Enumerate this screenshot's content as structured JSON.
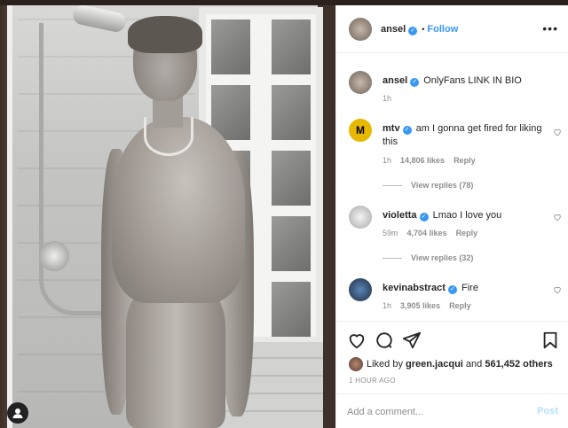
{
  "post": {
    "username": "ansel",
    "follow_label": "Follow",
    "dot": "•",
    "more_label": "•••",
    "caption": "OnlyFans LINK IN BIO",
    "caption_time": "1h"
  },
  "comments": [
    {
      "user": "mtv",
      "text": "am I gonna get fired for liking this",
      "time": "1h",
      "likes": "14,806 likes",
      "reply_label": "Reply",
      "view_replies": "View replies (78)"
    },
    {
      "user": "violetta",
      "text": "Lmao I love you",
      "time": "59m",
      "likes": "4,704 likes",
      "reply_label": "Reply",
      "view_replies": "View replies (32)"
    },
    {
      "user": "kevinabstract",
      "text": "Fire",
      "time": "1h",
      "likes": "3,905 likes",
      "reply_label": "Reply"
    }
  ],
  "likes": {
    "prefix": "Liked by",
    "first_user": "green.jacqui",
    "and": "and",
    "others": "561,452 others"
  },
  "time_ago": "1 HOUR AGO",
  "comment_box": {
    "placeholder": "Add a comment...",
    "post_label": "Post"
  },
  "logo_text": {
    "mtv": "M"
  },
  "colors": {
    "accent": "#3897f0",
    "post_disabled": "#b2dffc",
    "meta": "#8e8e8e"
  },
  "icons": [
    "like-icon",
    "comment-icon",
    "share-icon",
    "save-icon",
    "verified-icon",
    "heart-icon",
    "more-icon",
    "user-tag-icon"
  ]
}
